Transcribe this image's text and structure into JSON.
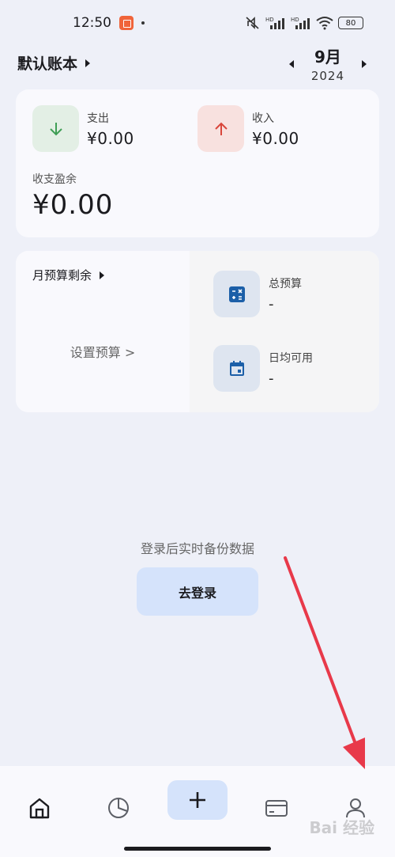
{
  "status": {
    "time": "12:50",
    "battery": "80",
    "signal_label_1": "HD",
    "signal_label_2": "HD"
  },
  "header": {
    "book_title": "默认账本",
    "month": "9月",
    "year": "2024"
  },
  "summary": {
    "expense_label": "支出",
    "expense_value": "¥0.00",
    "income_label": "收入",
    "income_value": "¥0.00",
    "balance_label": "收支盈余",
    "balance_value": "¥0.00"
  },
  "budget": {
    "title": "月预算剩余",
    "set_link": "设置预算 >",
    "total_label": "总预算",
    "total_value": "-",
    "daily_label": "日均可用",
    "daily_value": "-"
  },
  "login": {
    "hint": "登录后实时备份数据",
    "button_label": "去登录"
  },
  "nav": {
    "items": [
      "home-icon",
      "chart-icon",
      "add-icon",
      "card-icon",
      "profile-icon"
    ]
  },
  "watermark": "Bai 经验",
  "colors": {
    "background": "#eef0f8",
    "card": "#f9f9fd",
    "expense_icon_bg": "#e3efe5",
    "expense_green": "#3f9e55",
    "income_icon_bg": "#f8e1df",
    "income_red": "#d9463b",
    "budget_icon_bg": "#dee5f0",
    "budget_icon_blue": "#1c5fa8",
    "primary_container": "#d5e3fb",
    "annotation_arrow": "#e8394a"
  }
}
